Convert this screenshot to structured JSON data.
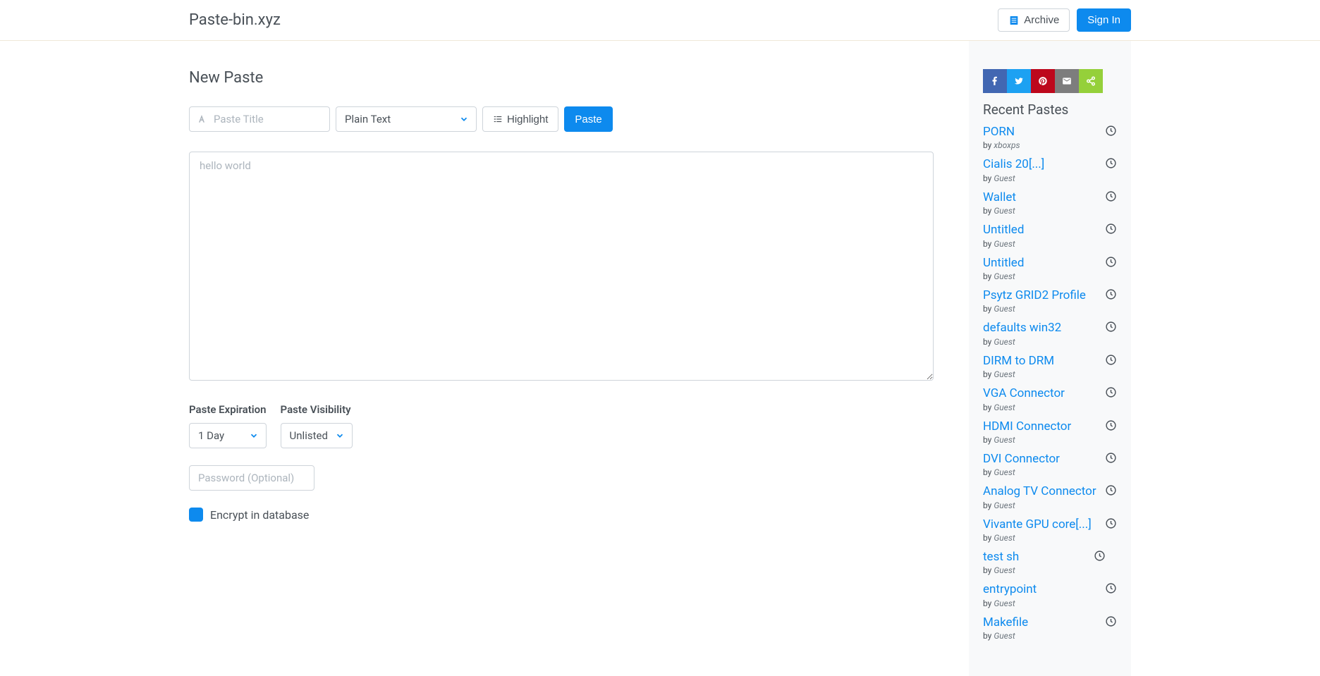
{
  "header": {
    "brand": "Paste-bin.xyz",
    "archive": "Archive",
    "signin": "Sign In"
  },
  "page": {
    "title": "New Paste",
    "paste_title_placeholder": "Paste Title",
    "syntax": "Plain Text",
    "highlight": "Highlight",
    "paste_btn": "Paste",
    "content_placeholder": "hello world",
    "expiration_label": "Paste Expiration",
    "expiration_value": "1 Day",
    "visibility_label": "Paste Visibility",
    "visibility_value": "Unlisted",
    "password_placeholder": "Password (Optional)",
    "encrypt_label": "Encrypt in database"
  },
  "sidebar": {
    "title": "Recent Pastes",
    "by_prefix": "by",
    "items": [
      {
        "title": "PORN",
        "author": "xboxps"
      },
      {
        "title": "Cialis 20[...]",
        "author": "Guest"
      },
      {
        "title": "Wallet",
        "author": "Guest"
      },
      {
        "title": "Untitled",
        "author": "Guest"
      },
      {
        "title": "Untitled",
        "author": "Guest"
      },
      {
        "title": "Psytz GRID2 Profile",
        "author": "Guest"
      },
      {
        "title": "defaults win32",
        "author": "Guest"
      },
      {
        "title": "DIRM to DRM",
        "author": "Guest"
      },
      {
        "title": "VGA Connector",
        "author": "Guest"
      },
      {
        "title": "HDMI Connector",
        "author": "Guest"
      },
      {
        "title": "DVI Connector",
        "author": "Guest"
      },
      {
        "title": "Analog TV Connector",
        "author": "Guest"
      },
      {
        "title": "Vivante GPU core[...]",
        "author": "Guest"
      },
      {
        "title": "test sh",
        "author": "Guest",
        "clock_offset": true
      },
      {
        "title": "entrypoint",
        "author": "Guest"
      },
      {
        "title": "Makefile",
        "author": "Guest"
      }
    ]
  },
  "share": {
    "buttons": [
      {
        "name": "facebook",
        "bg": "#4267B2"
      },
      {
        "name": "twitter",
        "bg": "#1DA1F2"
      },
      {
        "name": "pinterest",
        "bg": "#BD081C"
      },
      {
        "name": "email",
        "bg": "#7D7D7D"
      },
      {
        "name": "share",
        "bg": "#95D03A"
      }
    ]
  }
}
